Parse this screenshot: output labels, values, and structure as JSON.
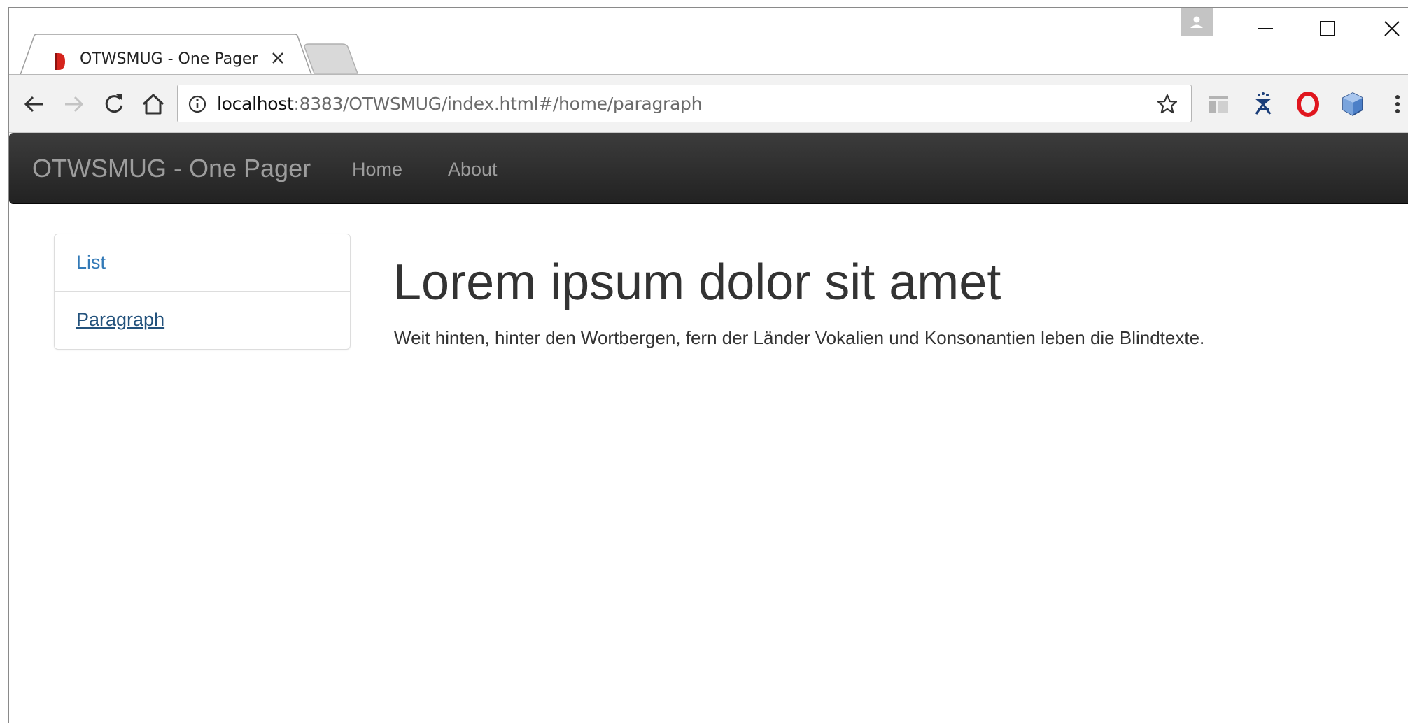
{
  "browser": {
    "tab": {
      "title": "OTWSMUG - One Pager"
    },
    "address_bar": {
      "host": "localhost",
      "rest": ":8383/OTWSMUG/index.html#/home/paragraph"
    },
    "icons": {
      "back": "back-arrow-icon",
      "forward": "forward-arrow-icon",
      "reload": "reload-icon",
      "home": "home-icon",
      "info": "info-icon",
      "bookmark": "star-icon",
      "extensions": [
        "reader-mode-icon",
        "extension-gremlin-icon",
        "opera-icon",
        "cube-icon"
      ],
      "menu": "kebab-menu-icon"
    }
  },
  "navbar": {
    "brand": "OTWSMUG - One Pager",
    "links": [
      {
        "label": "Home"
      },
      {
        "label": "About"
      }
    ],
    "colors": {
      "background": "#222222",
      "text": "#9d9d9d"
    }
  },
  "sidebar": {
    "items": [
      {
        "label": "List"
      },
      {
        "label": "Paragraph"
      }
    ],
    "link_color": "#337ab7"
  },
  "main": {
    "heading": "Lorem ipsum dolor sit amet",
    "paragraph": "Weit hinten, hinter den Wortbergen, fern der Länder Vokalien und Konsonantien leben die Blindtexte."
  }
}
